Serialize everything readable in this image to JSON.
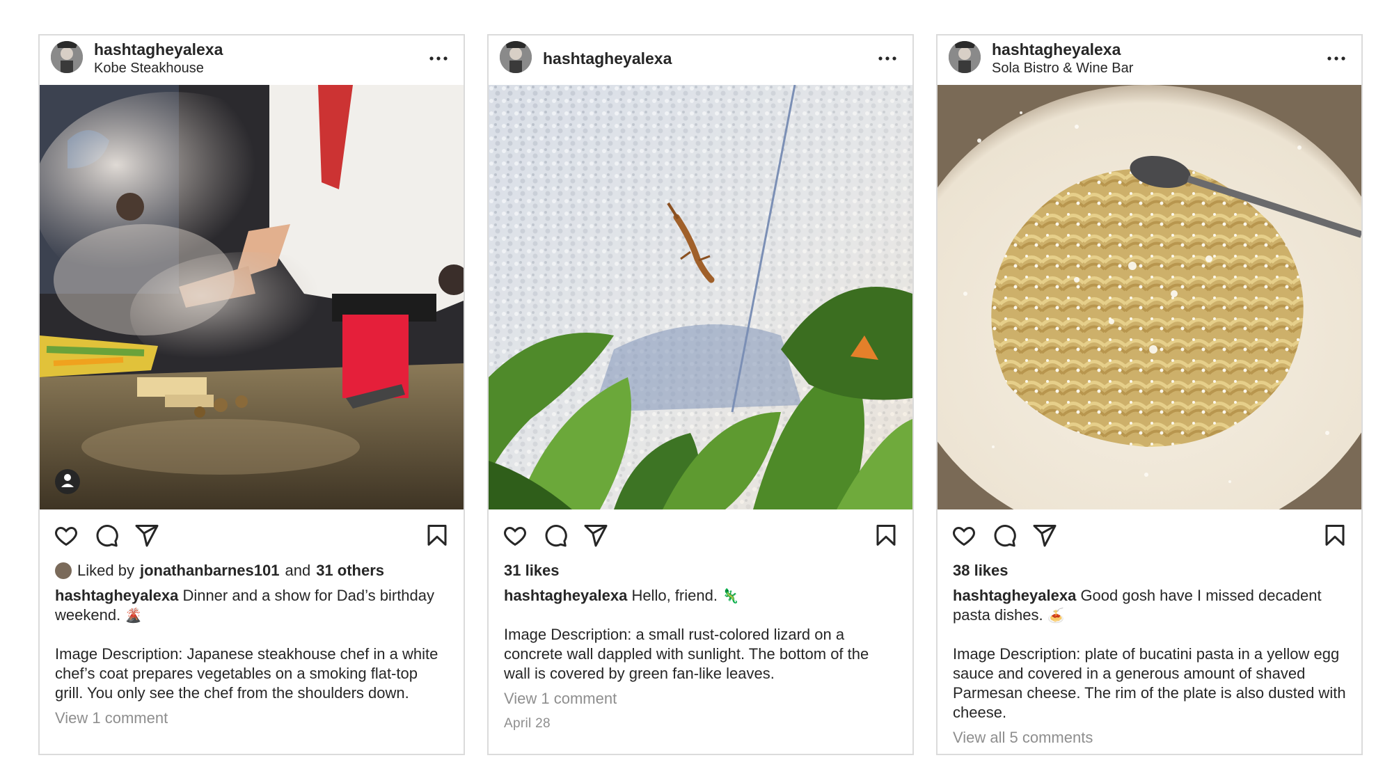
{
  "posts": [
    {
      "username": "hashtagheyalexa",
      "location": "Kobe Steakhouse",
      "liked_by_prefix": "Liked by",
      "liked_by_user": "jonathanbarnes101",
      "liked_by_and": "and",
      "liked_by_others": "31 others",
      "caption_user": "hashtagheyalexa",
      "caption_text": "Dinner and a show for Dad’s birthday weekend.",
      "caption_emoji": "🌋",
      "description": "Image Description: Japanese steakhouse chef in a white chef’s coat prepares vegetables on a smoking flat-top grill. You only see the chef from the shoulders down.",
      "comments_link": "View 1 comment"
    },
    {
      "username": "hashtagheyalexa",
      "likes": "31 likes",
      "caption_user": "hashtagheyalexa",
      "caption_text": "Hello, friend.",
      "caption_emoji": "🦎",
      "description": "Image Description: a small rust-colored lizard on a concrete wall dappled with sunlight. The bottom of the wall is covered by green fan-like leaves.",
      "comments_link": "View 1 comment",
      "date": "April 28"
    },
    {
      "username": "hashtagheyalexa",
      "location": "Sola Bistro & Wine Bar",
      "likes": "38 likes",
      "caption_user": "hashtagheyalexa",
      "caption_text": "Good gosh have I missed decadent pasta dishes.",
      "caption_emoji": "🍝",
      "description": "Image Description: plate of bucatini pasta in a yellow egg sauce and covered in a generous amount of shaved Parmesan cheese. The rim of the plate is also dusted with cheese.",
      "comments_link": "View all 5 comments"
    }
  ],
  "icons": {
    "more": "more-options-icon",
    "like": "heart-icon",
    "comment": "comment-icon",
    "share": "send-icon",
    "save": "bookmark-icon",
    "tag": "user-tag-icon"
  },
  "colors": {
    "text": "#262626",
    "muted": "#8e8e8e",
    "border": "#dbdbdb"
  }
}
